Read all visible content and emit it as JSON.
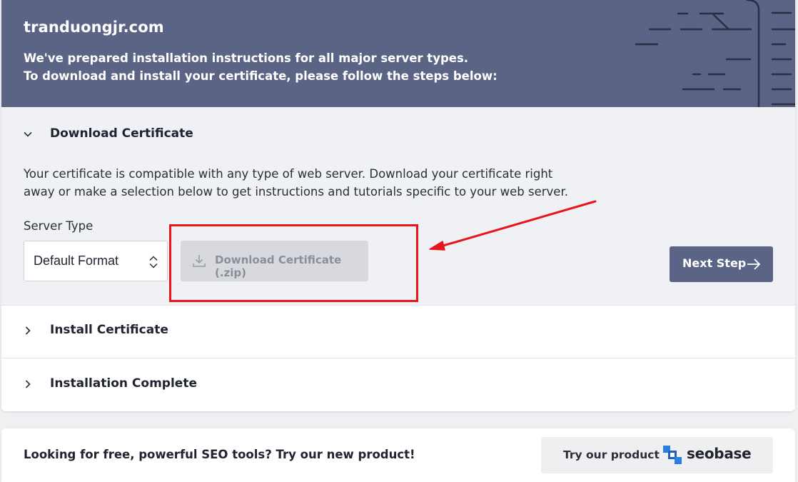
{
  "header": {
    "domain": "tranduongjr.com",
    "intro_line1": "We've prepared installation instructions for all major server types.",
    "intro_line2": "To download and install your certificate, please follow the steps below:"
  },
  "steps": {
    "download": {
      "title": "Download Certificate",
      "expanded": true,
      "description_line1": "Your certificate is compatible with any type of web server. Download your certificate right",
      "description_line2": "away or make a selection below to get instructions and tutorials specific to your web server.",
      "server_type_label": "Server Type",
      "server_type_value": "Default Format",
      "download_button_label": "Download Certificate (.zip)",
      "next_button_label": "Next Step"
    },
    "install": {
      "title": "Install Certificate",
      "expanded": false
    },
    "complete": {
      "title": "Installation Complete",
      "expanded": false
    }
  },
  "promo": {
    "text": "Looking for free, powerful SEO tools? Try our new product!",
    "button_label": "Try our product",
    "brand_name": "seobase"
  },
  "icons": {
    "expanded_chevron": "chevron-down-icon",
    "collapsed_chevron": "chevron-right-icon",
    "select_arrows": "select-updown-icon",
    "download": "download-icon",
    "next": "arrow-right-icon",
    "brand": "seobase-logo-icon"
  },
  "colors": {
    "header_bg": "#5b6484",
    "primary_button": "#5b6484",
    "disabled_button": "#d7d9de",
    "annotation_red": "#e8151b",
    "brand_blue": "#2a7de1"
  }
}
